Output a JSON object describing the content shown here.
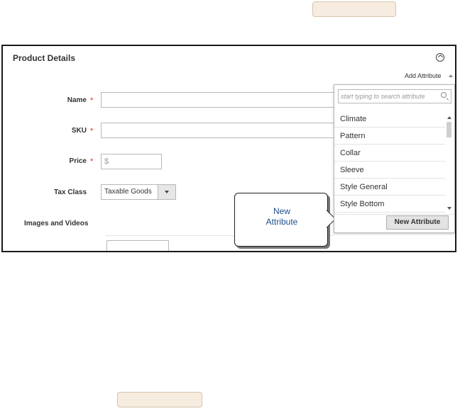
{
  "section": {
    "title": "Product Details",
    "add_attribute": "Add Attribute"
  },
  "form": {
    "name_label": "Name",
    "sku_label": "SKU",
    "price_label": "Price",
    "price_prefix": "$",
    "tax_class_label": "Tax Class",
    "tax_class_value": "Taxable Goods",
    "images_label": "Images and Videos",
    "required_mark": "*"
  },
  "dropdown": {
    "search_placeholder": "start typing to search attribute",
    "items": [
      "Climate",
      "Pattern",
      "Collar",
      "Sleeve",
      "Style General",
      "Style Bottom"
    ],
    "new_attribute_button": "New Attribute"
  },
  "callout": {
    "line1": "New",
    "line2": "Attribute"
  },
  "colors": {
    "required": "#e22626",
    "callout_text": "#1e4e8c",
    "pill_fill": "#f7ece0"
  }
}
